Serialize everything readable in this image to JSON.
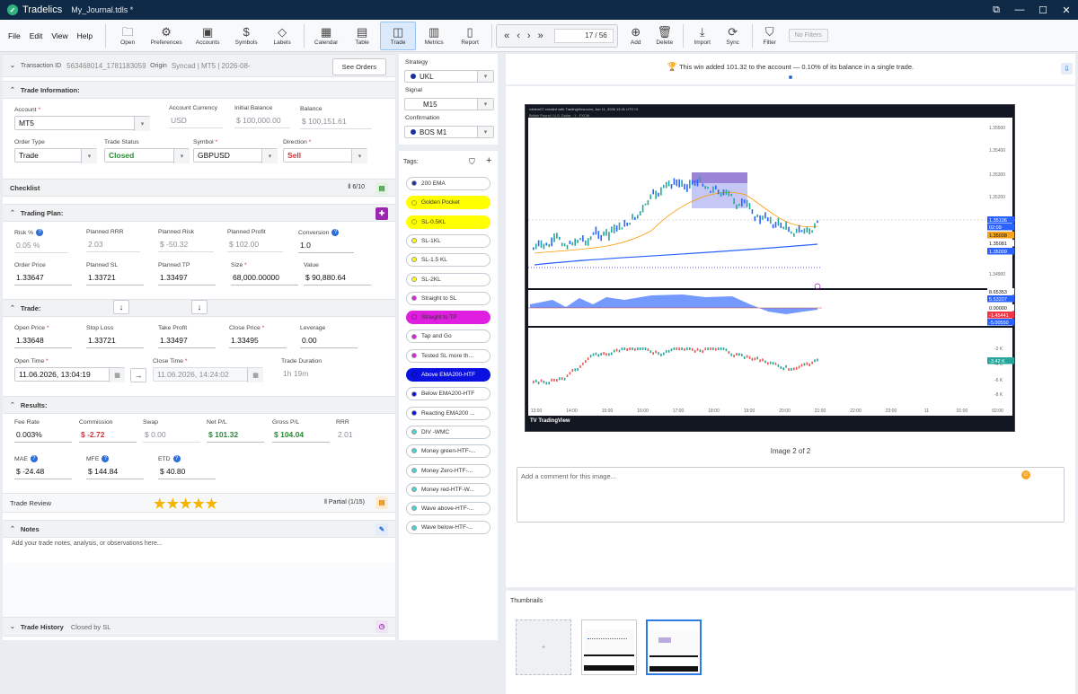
{
  "app": {
    "name": "Tradelics",
    "file": "My_Journal.tdls *"
  },
  "window": {
    "restore": "⧉",
    "minimize": "—",
    "maximize": "☐",
    "close": "✕"
  },
  "menu": [
    "File",
    "Edit",
    "View",
    "Help"
  ],
  "toolbar": {
    "open": "Open",
    "preferences": "Preferences",
    "accounts": "Accounts",
    "symbols": "Symbols",
    "labels": "Labels",
    "calendar": "Calendar",
    "table": "Table",
    "trade": "Trade",
    "metrics": "Metrics",
    "report": "Report",
    "page": "17 / 56",
    "add": "Add",
    "delete": "Delete",
    "import": "Import",
    "sync": "Sync",
    "filter": "Filter",
    "no_filters": "No Filters"
  },
  "left": {
    "transaction_label": "Transaction ID",
    "transaction_id": "563468014_1781183059(",
    "origin_label": "Origin",
    "origin_value": "Syncad | MT5 | 2026-08-",
    "see_orders": "See Orders",
    "trade_info_title": "Trade Information:",
    "account_label": "Account",
    "account_value": "MT5",
    "currency_label": "Account Currency",
    "currency_value": "USD",
    "initial_balance_label": "Initial Balance",
    "initial_balance_value": "$ 100,000.00",
    "balance_label": "Balance",
    "balance_value": "$ 100,151.61",
    "order_type_label": "Order Type",
    "order_type_value": "Trade",
    "status_label": "Trade Status",
    "status_value": "Closed",
    "symbol_label": "Symbol",
    "symbol_value": "GBPUSD",
    "direction_label": "Direction",
    "direction_value": "Sell",
    "checklist_title": "Checklist",
    "checklist_count": "6/10",
    "plan_title": "Trading Plan:",
    "risk_pct_label": "Risk %",
    "risk_pct_value": "0.05 %",
    "planned_rrr_label": "Planned RRR",
    "planned_rrr_value": "2.03",
    "planned_risk_label": "Planned Risk",
    "planned_risk_value": "$ -50.32",
    "planned_profit_label": "Planned Profit",
    "planned_profit_value": "$ 102.00",
    "conversion_label": "Conversion",
    "conversion_value": "1.0",
    "order_price_label": "Order Price",
    "order_price_value": "1.33647",
    "planned_sl_label": "Planned SL",
    "planned_sl_value": "1.33721",
    "planned_tp_label": "Planned TP",
    "planned_tp_value": "1.33497",
    "size_label": "Size",
    "size_value": "68,000.00000",
    "value_label": "Value",
    "value_value": "$ 90,880.64",
    "trade_title": "Trade:",
    "open_price_label": "Open Price",
    "open_price_value": "1.33648",
    "stop_loss_label": "Stop Loss",
    "stop_loss_value": "1.33721",
    "take_profit_label": "Take Profit",
    "take_profit_value": "1.33497",
    "close_price_label": "Close Price",
    "close_price_value": "1.33495",
    "leverage_label": "Leverage",
    "leverage_value": "0.00",
    "open_time_label": "Open Time",
    "open_time_value": "11.06.2026, 13:04:19",
    "close_time_label": "Close Time",
    "close_time_value": "11.06.2026, 14:24:02",
    "duration_label": "Trade Duration",
    "duration_value": "1h 19m",
    "results_title": "Results:",
    "fee_rate_label": "Fee Rate",
    "fee_rate_value": "0.003%",
    "commission_label": "Commission",
    "commission_value": "$ -2.72",
    "swap_label": "Swap",
    "swap_value": "$ 0.00",
    "net_pl_label": "Net P/L",
    "net_pl_value": "$ 101.32",
    "gross_pl_label": "Gross P/L",
    "gross_pl_value": "$ 104.04",
    "rrr_label": "RRR",
    "rrr_value": "2.01",
    "mae_label": "MAE",
    "mae_value": "$ -24.48",
    "mfe_label": "MFE",
    "mfe_value": "$ 144.84",
    "etd_label": "ETD",
    "etd_value": "$ 40.80",
    "review_title": "Trade Review",
    "review_stars": "★★★★★",
    "review_partial": "Partial",
    "review_count": "(1/15)",
    "notes_title": "Notes",
    "notes_placeholder": "Add your trade notes, analysis, or observations here...",
    "history_title": "Trade History",
    "history_value": "Closed by SL"
  },
  "middle": {
    "strategy_label": "Strategy",
    "strategy_value": "UKL",
    "signal_label": "Signal",
    "signal_value": "M15",
    "confirmation_label": "Confirmation",
    "confirmation_value": "BOS M1",
    "tags_label": "Tags:",
    "tags": [
      {
        "label": "200 EMA",
        "bg": "#ffffff",
        "dot": "#1c2fa0",
        "fg": "#333333"
      },
      {
        "label": "Golden Pocket",
        "bg": "#ffff00",
        "dot": "#ffff00",
        "fg": "#333333"
      },
      {
        "label": "SL-0.5KL",
        "bg": "#ffff00",
        "dot": "#ffff00",
        "fg": "#333333"
      },
      {
        "label": "SL-1KL",
        "bg": "#ffffff",
        "dot": "#ffff00",
        "fg": "#333333"
      },
      {
        "label": "SL-1.5 KL",
        "bg": "#ffffff",
        "dot": "#ffff00",
        "fg": "#333333"
      },
      {
        "label": "SL-2KL",
        "bg": "#ffffff",
        "dot": "#ffff00",
        "fg": "#333333"
      },
      {
        "label": "Straight to SL",
        "bg": "#ffffff",
        "dot": "#e01ee0",
        "fg": "#333333"
      },
      {
        "label": "Straight to TP",
        "bg": "#e01ee0",
        "dot": "#e01ee0",
        "fg": "#333333"
      },
      {
        "label": "Tap and Go",
        "bg": "#ffffff",
        "dot": "#e01ee0",
        "fg": "#333333"
      },
      {
        "label": "Tested SL more th...",
        "bg": "#ffffff",
        "dot": "#e01ee0",
        "fg": "#333333"
      },
      {
        "label": "Above EMA200-HTF",
        "bg": "#0a10e0",
        "dot": "#0a10e0",
        "fg": "#ffffff"
      },
      {
        "label": "Below EMA200-HTF",
        "bg": "#ffffff",
        "dot": "#0a10e0",
        "fg": "#333333"
      },
      {
        "label": "Reacting EMA200 ...",
        "bg": "#ffffff",
        "dot": "#0a10e0",
        "fg": "#333333"
      },
      {
        "label": "DIV -WMC",
        "bg": "#ffffff",
        "dot": "#3fd6d0",
        "fg": "#333333"
      },
      {
        "label": "Money green-HTF-...",
        "bg": "#ffffff",
        "dot": "#3fd6d0",
        "fg": "#333333"
      },
      {
        "label": "Money Zero-HTF-...",
        "bg": "#ffffff",
        "dot": "#3fd6d0",
        "fg": "#333333"
      },
      {
        "label": "Money red-HTF-W...",
        "bg": "#ffffff",
        "dot": "#3fd6d0",
        "fg": "#333333"
      },
      {
        "label": "Wave above-HTF-...",
        "bg": "#ffffff",
        "dot": "#3fd6d0",
        "fg": "#333333"
      },
      {
        "label": "Wave below-HTF-...",
        "bg": "#ffffff",
        "dot": "#3fd6d0",
        "fg": "#333333"
      }
    ]
  },
  "right": {
    "banner": "This win added 101.32 to the account — 0.10% of its balance in a single trade.",
    "image_caption": "Image 2 of 2",
    "comment_placeholder": "Add a comment for this image...",
    "thumbnails_label": "Thumbnails",
    "chart_header": "roblem07 created with TradingView.com, Jun 11, 2026 13:41 UTC+3",
    "chart_subheader": "British Pound / U.S. Dollar · 1 · FXCM",
    "chart_brand": "TradingView",
    "price_ticks": [
      "1.35500",
      "1.35400",
      "1.35300",
      "1.35200",
      "1.35100",
      "1.34900"
    ],
    "price_badges": [
      {
        "text": "1.35106",
        "color": "#2962ff"
      },
      {
        "text": "02:09",
        "color": "#2962ff"
      },
      {
        "text": "1.35038",
        "color": "#f7a21b"
      },
      {
        "text": "1.35081",
        "color": "#ffffff"
      },
      {
        "text": "1.35009",
        "color": "#2962ff"
      }
    ],
    "osc_badges": [
      {
        "text": "8.65353",
        "color": "#ffffff"
      },
      {
        "text": "5.53207",
        "color": "#2962ff"
      },
      {
        "text": "0.00000",
        "color": "#ffffff"
      },
      {
        "text": "-1.45441",
        "color": "#f23645"
      },
      {
        "text": "-5.00550",
        "color": "#2962ff"
      }
    ],
    "vol_ticks": [
      "-2 K",
      "-4 K",
      "-6 K",
      "-8 K"
    ],
    "vol_badge": "-3.42 K",
    "time_ticks": [
      "13:00",
      "14:00",
      "15:00",
      "16:00",
      "17:00",
      "18:00",
      "19:00",
      "20:00",
      "21:00",
      "22:00",
      "23:00",
      "11",
      "01:00",
      "02:00"
    ]
  }
}
